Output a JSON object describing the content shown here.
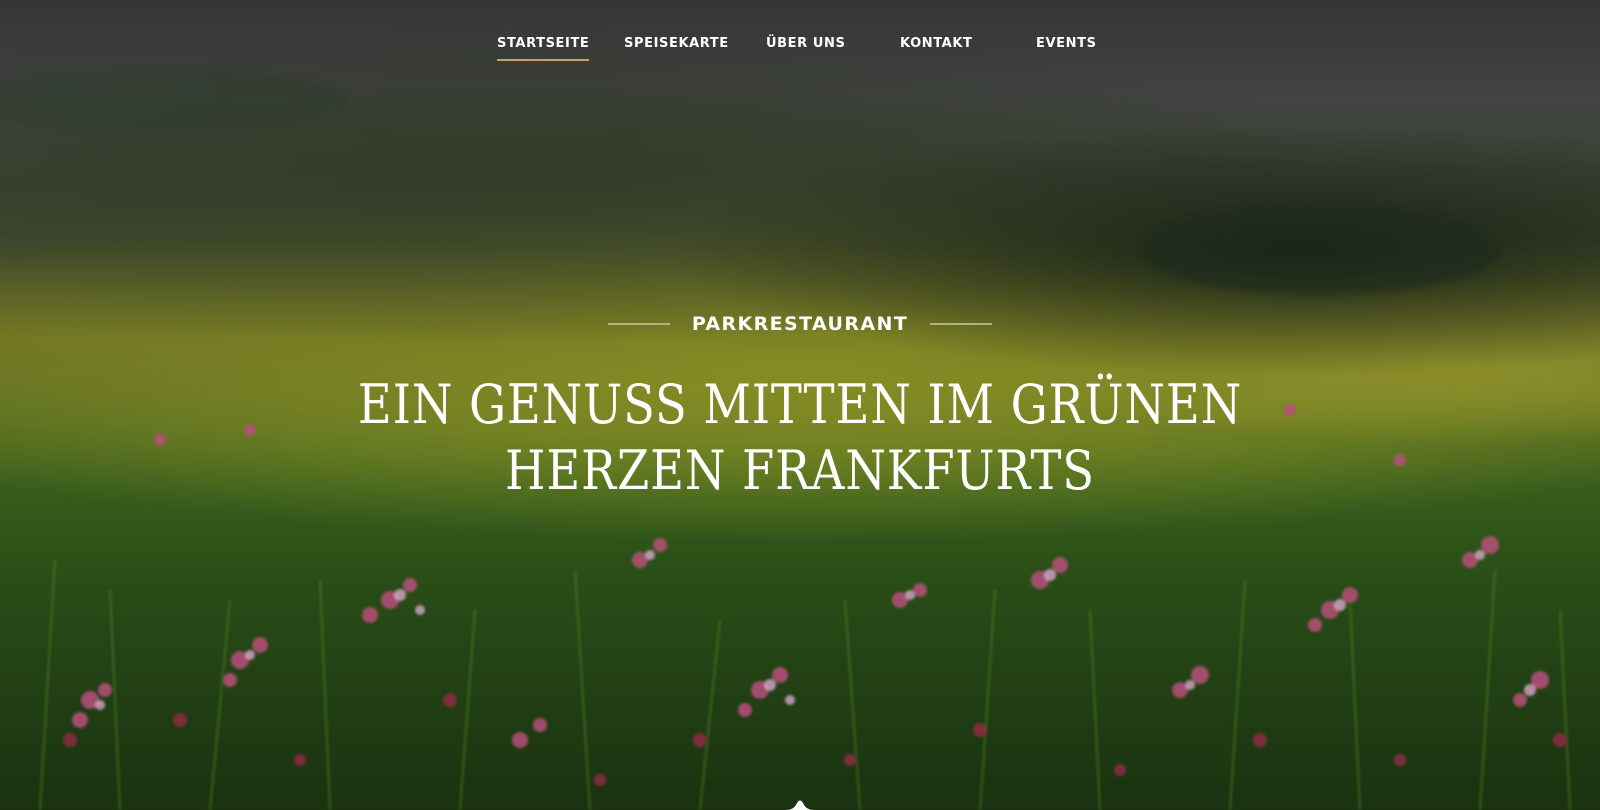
{
  "nav": {
    "items": [
      {
        "label": "STARTSEITE",
        "active": true
      },
      {
        "label": "SPEISEKARTE",
        "active": false
      },
      {
        "label": "ÜBER UNS",
        "active": false
      },
      {
        "label": "KONTAKT",
        "active": false
      },
      {
        "label": "EVENTS",
        "active": false
      }
    ],
    "active_underline_color": "#c9a063"
  },
  "hero": {
    "kicker": "PARKRESTAURANT",
    "headline_line1": "EIN GENUSS MITTEN IM GRÜNEN",
    "headline_line2": "HERZEN FRANKFURTS",
    "text_color": "#ffffff"
  },
  "scroll_indicator": {
    "icon": "chevron-up-notch-icon"
  }
}
